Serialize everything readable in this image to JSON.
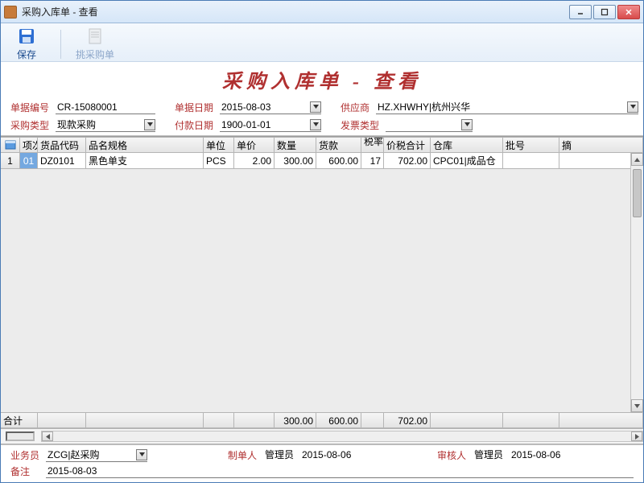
{
  "window": {
    "title": "采购入库单 - 查看"
  },
  "toolbar": {
    "save": "保存",
    "pick": "挑采购单"
  },
  "page_title": "采购入库单 - 查看",
  "header": {
    "doc_no_label": "单据编号",
    "doc_no": "CR-15080001",
    "doc_date_label": "单据日期",
    "doc_date": "2015-08-03",
    "supplier_label": "供应商",
    "supplier": "HZ.XHWHY|杭州兴华",
    "purch_type_label": "采购类型",
    "purch_type": "现款采购",
    "pay_date_label": "付款日期",
    "pay_date": "1900-01-01",
    "invoice_type_label": "发票类型",
    "invoice_type": ""
  },
  "cols": {
    "seq": "项次",
    "code": "货品代码",
    "spec": "品名规格",
    "unit": "单位",
    "price": "单价",
    "qty": "数量",
    "amt": "货款",
    "tax": "税率%",
    "taxamt": "价税合计",
    "wh": "仓库",
    "batch": "批号",
    "rem": "摘"
  },
  "rows": [
    {
      "idx": "1",
      "seq": "01",
      "code": "DZ0101",
      "spec": "黑色单支",
      "unit": "PCS",
      "price": "2.00",
      "qty": "300.00",
      "amt": "600.00",
      "tax": "17",
      "taxamt": "702.00",
      "wh": "CPC01|成品仓",
      "batch": "",
      "rem": ""
    }
  ],
  "totals": {
    "label": "合计",
    "qty": "300.00",
    "amt": "600.00",
    "taxamt": "702.00"
  },
  "footer": {
    "sales_label": "业务员",
    "sales": "ZCG|赵采购",
    "maker_label": "制单人",
    "maker": "管理员",
    "maker_date": "2015-08-06",
    "checker_label": "审核人",
    "checker": "管理员",
    "checker_date": "2015-08-06",
    "remark_label": "备注",
    "remark": "2015-08-03"
  }
}
